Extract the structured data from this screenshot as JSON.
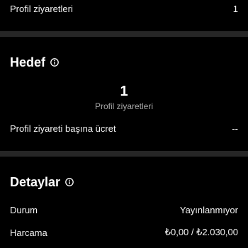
{
  "top_row": {
    "label": "Profil ziyaretleri",
    "value": "1"
  },
  "goal": {
    "title": "Hedef",
    "metric_value": "1",
    "metric_label": "Profil ziyaretleri",
    "cost_label": "Profil ziyareti başına ücret",
    "cost_value": "--"
  },
  "details": {
    "title": "Detaylar",
    "status_label": "Durum",
    "status_value": "Yayınlanmıyor",
    "spend_label": "Harcama",
    "spend_value": "₺0,00 / ₺2.030,00"
  },
  "colors": {
    "background": "#000000",
    "divider": "#262626",
    "muted": "#a8a8a8"
  },
  "icons": {
    "info": "info-circle-icon"
  }
}
